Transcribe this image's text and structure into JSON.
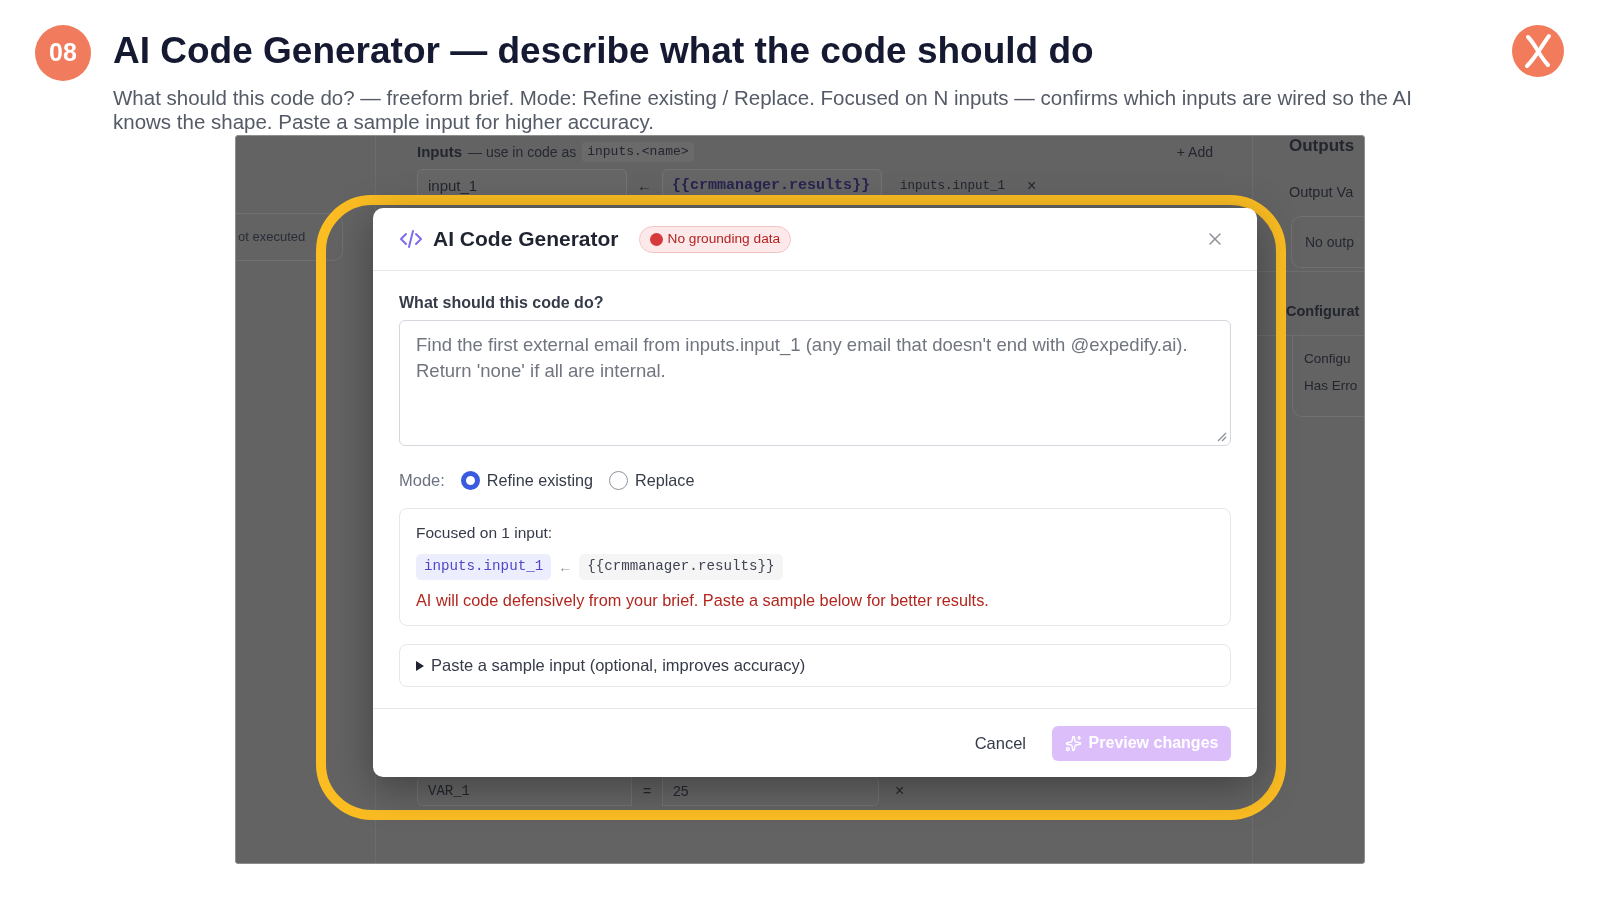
{
  "slide": {
    "number": "08",
    "title": "AI Code Generator — describe what the code should do",
    "description": "What should this code do? — freeform brief. Mode: Refine existing / Replace. Focused on N inputs — confirms which inputs are wired so the AI knows the shape. Paste a sample input for higher accuracy."
  },
  "background": {
    "status_card": "ot executed",
    "inputs": {
      "heading": "Inputs",
      "hint": "— use in code as",
      "hint_code": "inputs.<name>",
      "add_button": "+ Add",
      "rows": [
        {
          "name": "input_1",
          "arrow": "←",
          "source": "{{crmmanager.results}}",
          "alias": "inputs.input_1",
          "remove": "×"
        }
      ]
    },
    "variables": [
      {
        "name": "VAR_1",
        "operator": "=",
        "value": "25",
        "remove": "×"
      }
    ],
    "outputs": {
      "heading": "Outputs",
      "label": "Output Va",
      "empty_state": "No outp",
      "section": "Configurat",
      "details": [
        "Configu",
        "Has Erro"
      ]
    }
  },
  "dialog": {
    "title": "AI Code Generator",
    "badge": "No grounding data",
    "prompt": {
      "label": "What should this code do?",
      "placeholder": "Find the first external email from inputs.input_1 (any email that doesn't end with @expedify.ai). Return 'none' if all are internal."
    },
    "mode": {
      "label": "Mode:",
      "options": [
        {
          "label": "Refine existing",
          "selected": true
        },
        {
          "label": "Replace",
          "selected": false
        }
      ]
    },
    "focus": {
      "heading": "Focused on 1 input:",
      "inputs": [
        {
          "name": "inputs.input_1",
          "arrow": "←",
          "source": "{{crmmanager.results}}"
        }
      ],
      "warning": "AI will code defensively from your brief. Paste a sample below for better results."
    },
    "sample": {
      "label": "Paste a sample input (optional, improves accuracy)",
      "expanded": false
    },
    "buttons": [
      {
        "kind": "secondary",
        "label": "Cancel",
        "disabled": false
      },
      {
        "kind": "primary",
        "label": "Preview changes",
        "disabled": true
      }
    ]
  }
}
